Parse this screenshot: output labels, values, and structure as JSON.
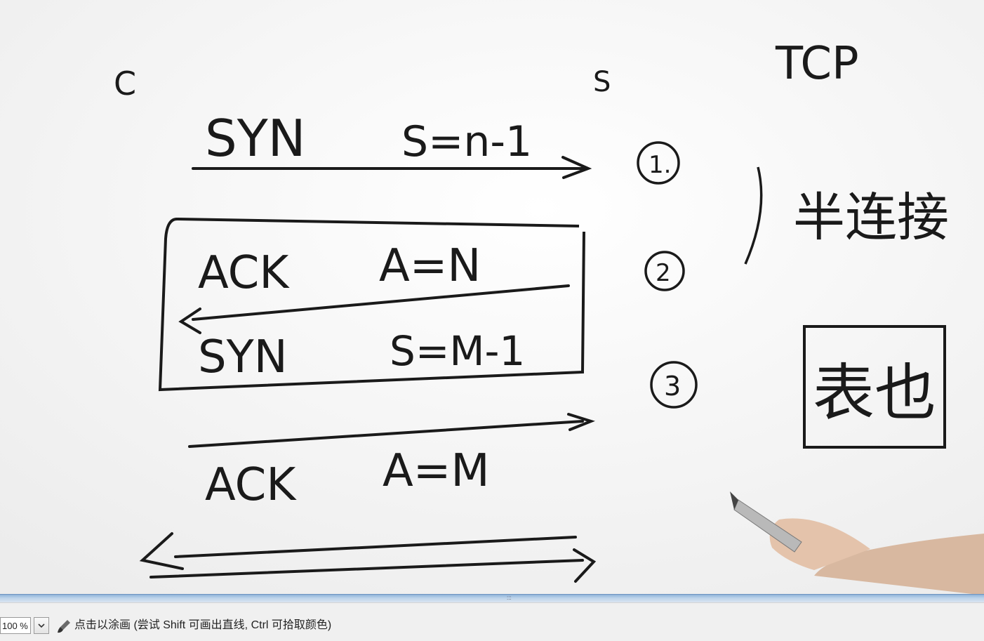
{
  "board": {
    "left_label": "C",
    "right_label": "S",
    "title": "TCP",
    "msg1": {
      "flag": "SYN",
      "value": "S=n-1"
    },
    "msg2a": {
      "flag": "ACK",
      "value": "A=N"
    },
    "msg2b": {
      "flag": "SYN",
      "value": "S=M-1"
    },
    "msg3": {
      "flag": "ACK",
      "value": "A=M"
    },
    "step1": "1.",
    "step2": "2",
    "step3": "3",
    "note_half": "半连接",
    "note_box": "表也"
  },
  "statusbar": {
    "zoom": "100 %",
    "hint": "点击以涂画 (尝试 Shift 可画出直线, Ctrl 可拾取颜色)"
  },
  "colors": {
    "ink": "#1a1a1a",
    "splitter": "#8fb3d9"
  }
}
